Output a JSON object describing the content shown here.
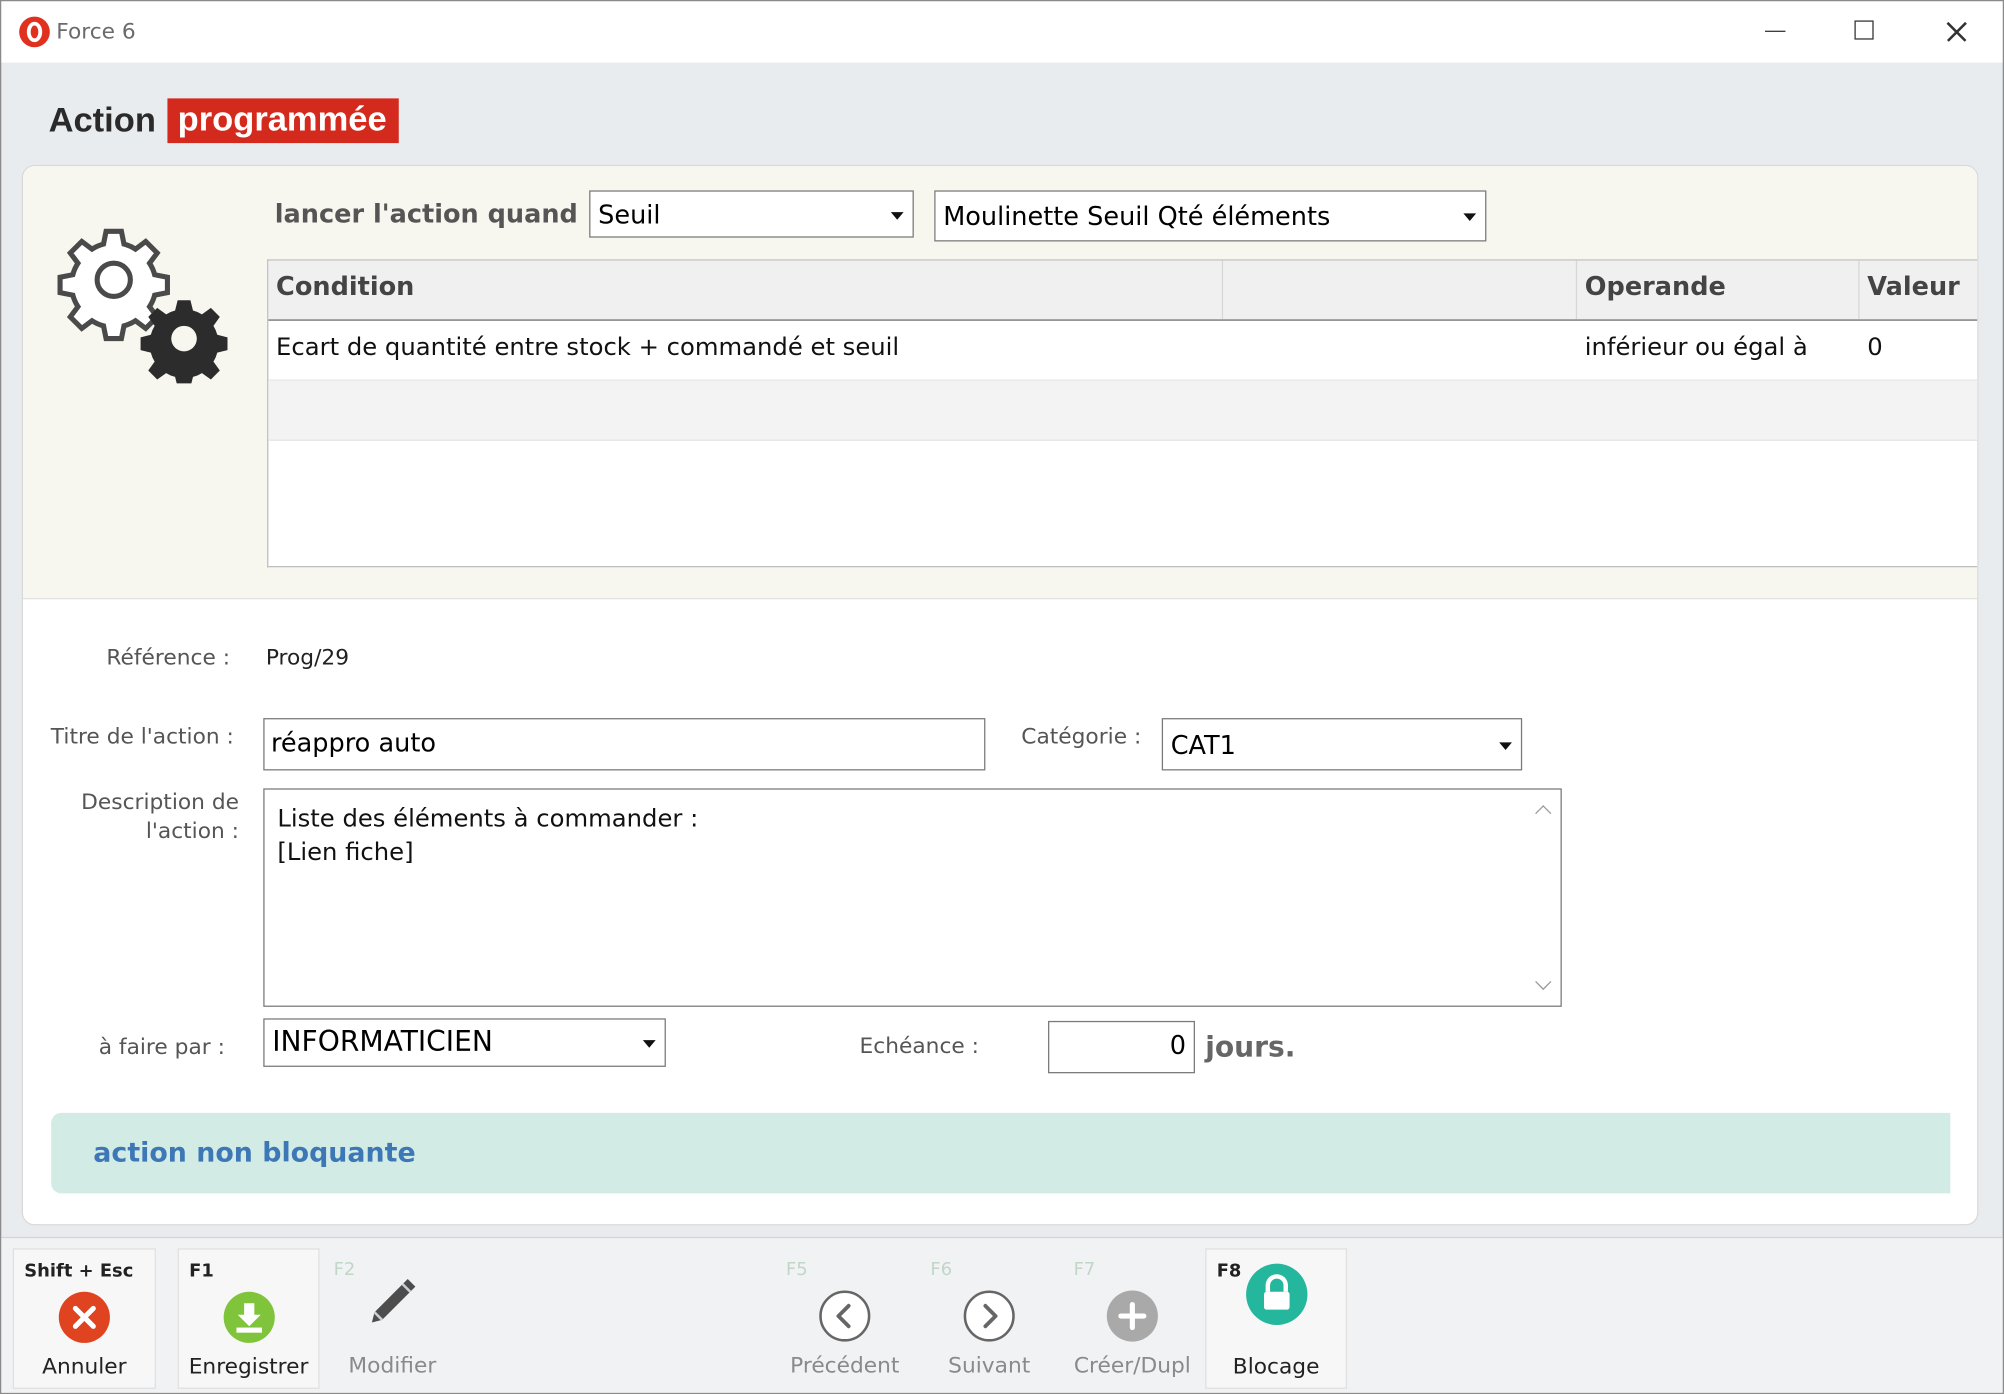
{
  "window": {
    "title": "Force 6"
  },
  "heading": {
    "main": "Action",
    "accent": "programmée"
  },
  "trigger": {
    "label": "lancer l'action quand",
    "type_value": "Seuil",
    "model_value": "Moulinette Seuil Qté éléments"
  },
  "conditions": {
    "columns": [
      "Condition",
      "",
      "Operande",
      "Valeur"
    ],
    "rows": [
      {
        "condition": "Ecart de quantité entre stock + commandé et seuil",
        "operande": "inférieur ou égal à",
        "valeur": "0"
      }
    ]
  },
  "form": {
    "reference_label": "Référence :",
    "reference_value": "Prog/29",
    "title_label": "Titre de l'action :",
    "title_value": "réappro auto",
    "category_label": "Catégorie :",
    "category_value": "CAT1",
    "description_label_line1": "Description de",
    "description_label_line2": "l'action :",
    "description_value": "Liste des éléments à commander :\n[Lien fiche]",
    "assignee_label": "à faire par :",
    "assignee_value": "INFORMATICIEN",
    "due_label": "Echéance :",
    "due_value": "0",
    "due_unit": "jours."
  },
  "banner": {
    "text": "action non bloquante",
    "bg_color": "#d2ece5",
    "text_color": "#3e77b6"
  },
  "toolbar": {
    "buttons": [
      {
        "key": "Shift + Esc",
        "label": "Annuler",
        "icon": "cancel-icon",
        "color": "#e0431f"
      },
      {
        "key": "F1",
        "label": "Enregistrer",
        "icon": "download-save-icon",
        "color": "#7fc43a"
      },
      {
        "key": "F2",
        "label": "Modifier",
        "icon": "pencil-icon"
      },
      {
        "key": "F5",
        "label": "Précédent",
        "icon": "chevron-left-icon"
      },
      {
        "key": "F6",
        "label": "Suivant",
        "icon": "chevron-right-icon"
      },
      {
        "key": "F7",
        "label": "Créer/Dupl",
        "icon": "plus-icon"
      },
      {
        "key": "F8",
        "label": "Blocage",
        "icon": "lock-icon",
        "color": "#25b79d"
      }
    ]
  },
  "colors": {
    "accent_red": "#d42a1d"
  }
}
